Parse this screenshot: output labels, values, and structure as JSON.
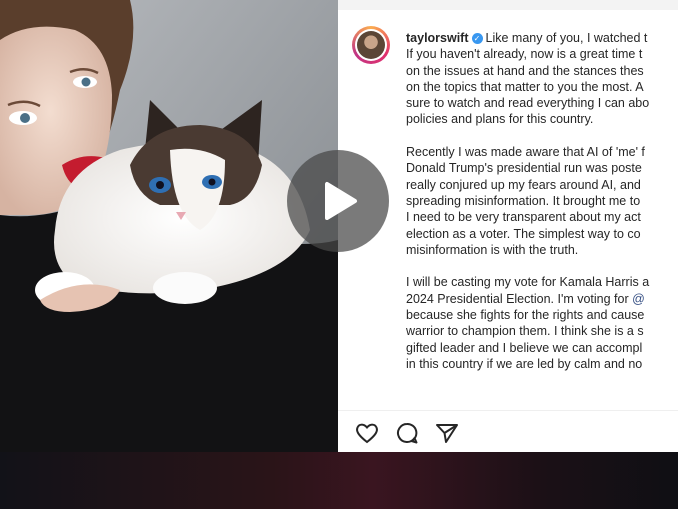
{
  "post": {
    "username": "taylorswift",
    "caption_first": "Like many of you, I watched t",
    "lines": [
      "If you haven't already, now is a great time t",
      "on the issues at hand and the stances thes",
      "on the topics that matter to you the most. A",
      "sure to watch and read everything I can abo",
      "policies and plans for this country.",
      "",
      "Recently I was made aware that AI of 'me' f",
      "Donald Trump's presidential run was poste",
      "really conjured up my fears around AI, and",
      "spreading misinformation. It brought me to",
      "I need to be very transparent about my act",
      "election as a voter. The simplest way to co",
      "misinformation is with the truth.",
      "",
      "I will be casting my vote for Kamala Harris a",
      "2024 Presidential Election. I'm voting for",
      "because she fights for the rights and cause",
      "warrior to champion them. I think she is a s",
      "gifted leader and I believe we can accompl",
      "in this country if we are led by calm and no"
    ],
    "mention_fragment": "@",
    "verified_symbol": "✓"
  },
  "actions": {
    "like_icon": "heart-icon",
    "comment_icon": "comment-icon",
    "share_icon": "send-icon"
  },
  "player": {
    "play_icon": "play-icon"
  },
  "colors": {
    "verified": "#3897f0",
    "mention": "#385185",
    "text": "#262626"
  }
}
